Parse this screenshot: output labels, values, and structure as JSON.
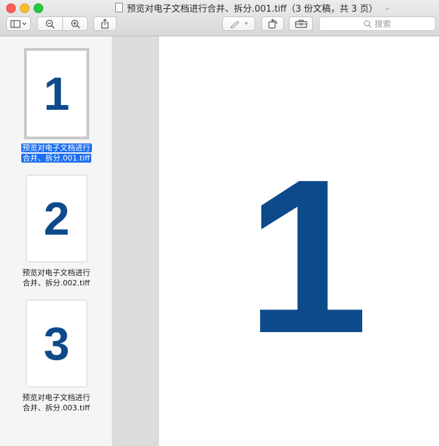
{
  "window": {
    "title": "预览对电子文档进行合并、拆分.001.tiff（3 份文稿，共 3 页）"
  },
  "toolbar": {
    "sidebar_toggle_icon": "sidebar-icon",
    "zoom_out_icon": "zoom-out-icon",
    "zoom_in_icon": "zoom-in-icon",
    "share_icon": "share-icon",
    "markup_icon": "pen-icon",
    "rotate_icon": "rotate-icon",
    "toolbox_icon": "toolbox-icon",
    "search_placeholder": "搜索"
  },
  "sidebar": {
    "items": [
      {
        "page_number": "1",
        "caption_line1": "预览对电子文档进行",
        "caption_line2": "合并、拆分.001.tiff",
        "selected": true
      },
      {
        "page_number": "2",
        "caption_line1": "预览对电子文档进行",
        "caption_line2": "合并、拆分.002.tiff",
        "selected": false
      },
      {
        "page_number": "3",
        "caption_line1": "预览对电子文档进行",
        "caption_line2": "合并、拆分.003.tiff",
        "selected": false
      }
    ]
  },
  "viewer": {
    "page_content": "1"
  },
  "colors": {
    "accent": "#0d4a8a",
    "selection": "#1c6ff2"
  }
}
